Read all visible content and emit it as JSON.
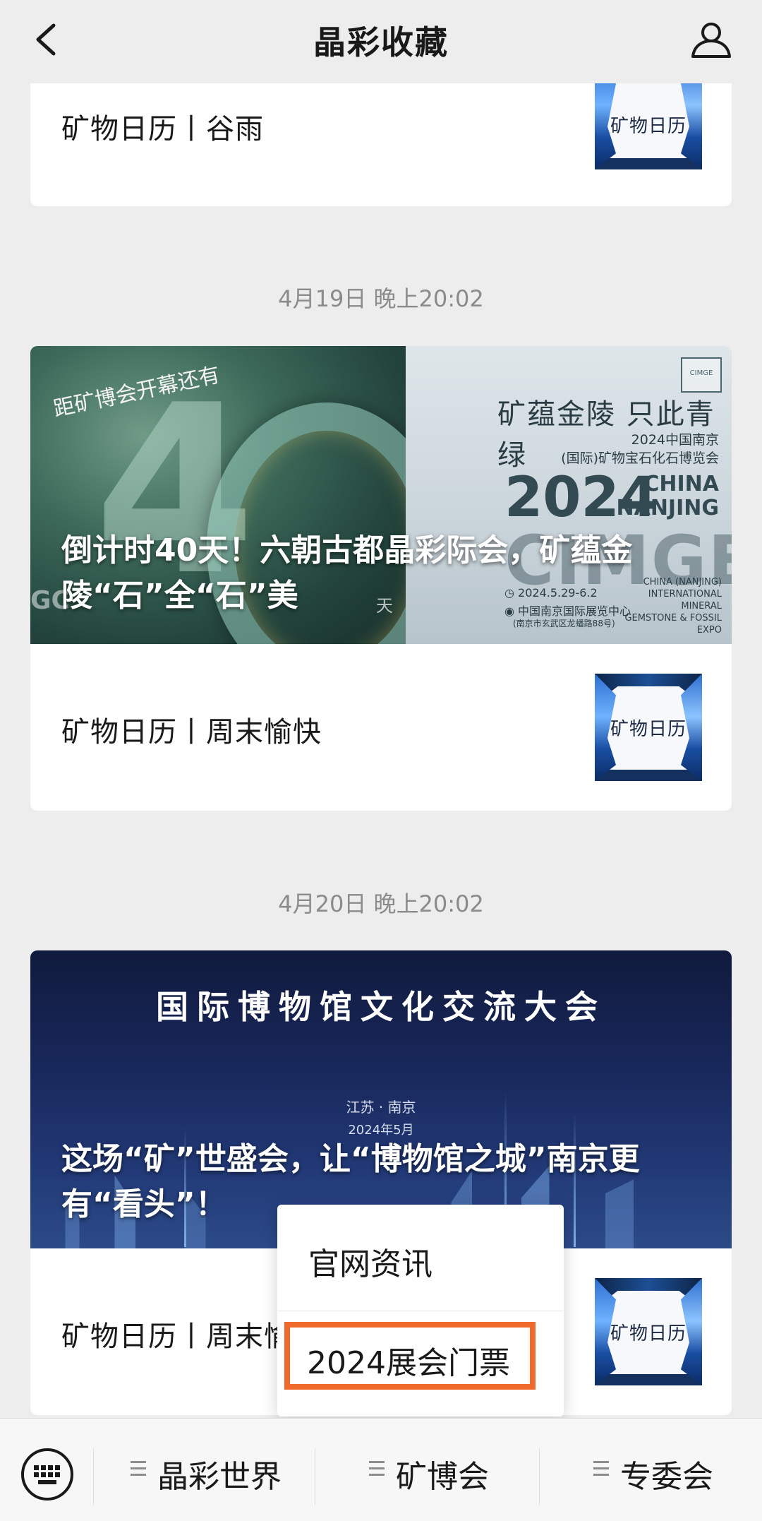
{
  "header": {
    "title": "晶彩收藏"
  },
  "cards": [
    {
      "rows": [
        {
          "title": "矿物日历丨谷雨",
          "thumb_text": "矿物日历"
        }
      ]
    },
    {
      "timestamp": "4月19日 晚上20:02",
      "hero": {
        "title": "倒计时40天！六朝古都晶彩际会，矿蕴金陵“石”全“石”美",
        "script_text": "距矿博会开幕还有",
        "day_char": "天",
        "gc_text": "GC",
        "slogan": "矿蕴金陵 只此青绿",
        "sub1": "2024中国南京",
        "sub2": "(国际)矿物宝石化石博览会",
        "year": "2024",
        "china": "CHINA",
        "nanjing": "NANJING",
        "acronym": "CIMGE",
        "date": "◷ 2024.5.29-6.2",
        "venue": "◉ 中国南京国际展览中心",
        "address": "(南京市玄武区龙蟠路88号)",
        "en_lines": [
          "CHINA (NANJING)",
          "INTERNATIONAL",
          "MINERAL",
          "GEMSTONE & FOSSIL",
          "EXPO"
        ],
        "logo": "CIMGE"
      },
      "rows": [
        {
          "title": "矿物日历丨周末愉快",
          "thumb_text": "矿物日历"
        }
      ]
    },
    {
      "timestamp": "4月20日 晚上20:02",
      "hero": {
        "headline": "国际博物馆文化交流大会",
        "location": "江苏 · 南京",
        "month": "2024年5月",
        "title": "这场“矿”世盛会，让“博物馆之城”南京更有“看头”！"
      },
      "rows": [
        {
          "title": "矿物日历丨周末愉快",
          "thumb_text": "矿物日历"
        }
      ]
    }
  ],
  "popup_menu": {
    "items": [
      "官网资讯",
      "2024展会门票"
    ],
    "highlight_color": "#f06a2b"
  },
  "bottom_menu": {
    "keyboard_icon": "keyboard-icon",
    "buttons": [
      "晶彩世界",
      "矿博会",
      "专委会"
    ]
  }
}
